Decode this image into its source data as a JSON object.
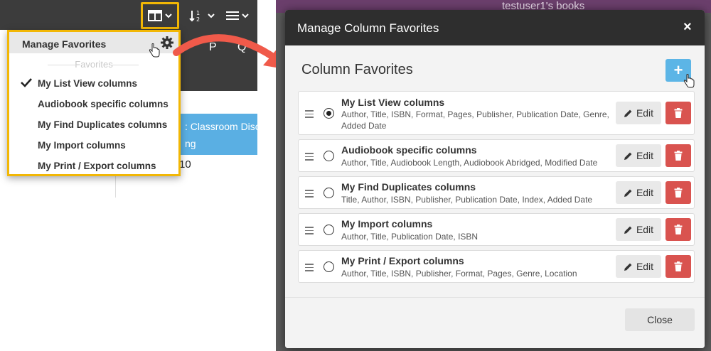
{
  "left": {
    "header_letters": [
      "P",
      "Q"
    ],
    "highlighted_row_lines": [
      ": Classroom Disco",
      "ng"
    ],
    "cell_value": "10",
    "dropdown": {
      "title": "Manage Favorites",
      "section_label": "Favorites",
      "items": [
        {
          "label": "My List View columns",
          "checked": true
        },
        {
          "label": "Audiobook specific columns",
          "checked": false
        },
        {
          "label": "My Find Duplicates columns",
          "checked": false
        },
        {
          "label": "My Import columns",
          "checked": false
        },
        {
          "label": "My Print / Export columns",
          "checked": false
        }
      ]
    }
  },
  "right": {
    "window_title": "testuser1's books",
    "modal": {
      "title": "Manage Column Favorites",
      "close_symbol": "×",
      "section_title": "Column Favorites",
      "add_symbol": "+",
      "edit_label": "Edit",
      "footer_close_label": "Close",
      "favorites": [
        {
          "name": "My List View columns",
          "selected": true,
          "columns": "Author, Title, ISBN, Format, Pages, Publisher, Publication Date, Genre, Added Date"
        },
        {
          "name": "Audiobook specific columns",
          "selected": false,
          "columns": "Author, Title, Audiobook Length, Audiobook Abridged, Modified Date"
        },
        {
          "name": "My Find Duplicates columns",
          "selected": false,
          "columns": "Title, Author, ISBN, Publisher, Publication Date, Index, Added Date"
        },
        {
          "name": "My Import columns",
          "selected": false,
          "columns": "Author, Title, Publication Date, ISBN"
        },
        {
          "name": "My Print / Export columns",
          "selected": false,
          "columns": "Author, Title, ISBN, Publisher, Format, Pages, Genre, Location"
        }
      ]
    }
  },
  "colors": {
    "highlight_border": "#f2b705",
    "toolbar_bg": "#3c3c3c",
    "modal_header_bg": "#2e2e2e",
    "add_button": "#5cb5e6",
    "delete_button": "#d9534f",
    "arrow": "#f05a4a",
    "selected_row": "#5aafe3"
  },
  "icons": {
    "columns_button": "columns-icon",
    "sort_button": "sort-icon",
    "menu_button": "hamburger-icon",
    "settings": "gear-icon",
    "check": "checkmark-icon",
    "drag": "drag-handle-icon",
    "edit": "pencil-icon",
    "delete": "trash-icon",
    "pointer": "hand-pointer-icon"
  }
}
